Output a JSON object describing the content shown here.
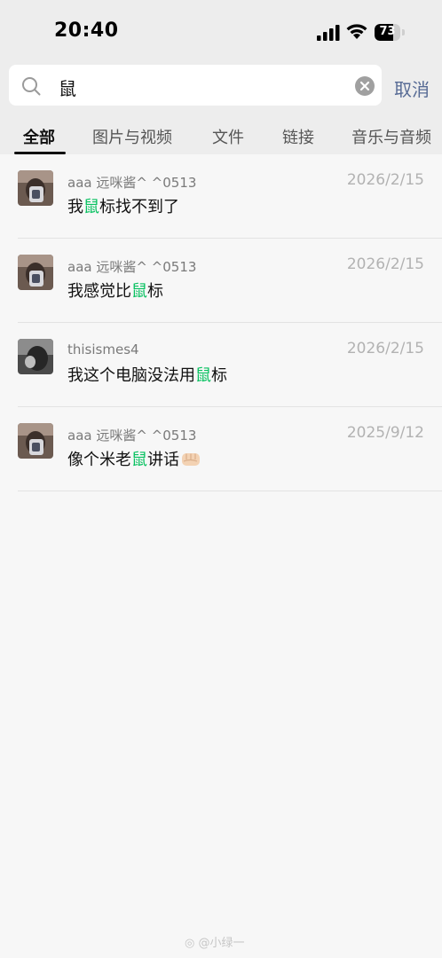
{
  "status_bar": {
    "time": "20:40",
    "battery_percent": 73,
    "battery_label": "73"
  },
  "search": {
    "query": "鼠",
    "cancel_label": "取消"
  },
  "tabs": [
    {
      "label": "全部",
      "active": true
    },
    {
      "label": "图片与视频",
      "active": false
    },
    {
      "label": "文件",
      "active": false
    },
    {
      "label": "链接",
      "active": false
    },
    {
      "label": "音乐与音频",
      "active": false
    }
  ],
  "results": [
    {
      "name": "aaa 远咪酱^ ^0513",
      "date": "2026/2/15",
      "pre": "我",
      "hl": "鼠",
      "post": "标找不到了",
      "emoji": ""
    },
    {
      "name": "aaa 远咪酱^ ^0513",
      "date": "2026/2/15",
      "pre": "我感觉比",
      "hl": "鼠",
      "post": "标",
      "emoji": ""
    },
    {
      "name": "thisismes4",
      "date": "2026/2/15",
      "pre": "我这个电脑没法用",
      "hl": "鼠",
      "post": "标",
      "emoji": ""
    },
    {
      "name": "aaa 远咪酱^ ^0513",
      "date": "2025/9/12",
      "pre": "像个米老",
      "hl": "鼠",
      "post": "讲话",
      "emoji": "fist-emoji"
    }
  ],
  "watermark": "@小绿一",
  "colors": {
    "highlight": "#07c160",
    "link": "#576b95",
    "header_bg": "#ededed",
    "page_bg": "#f7f7f7"
  }
}
